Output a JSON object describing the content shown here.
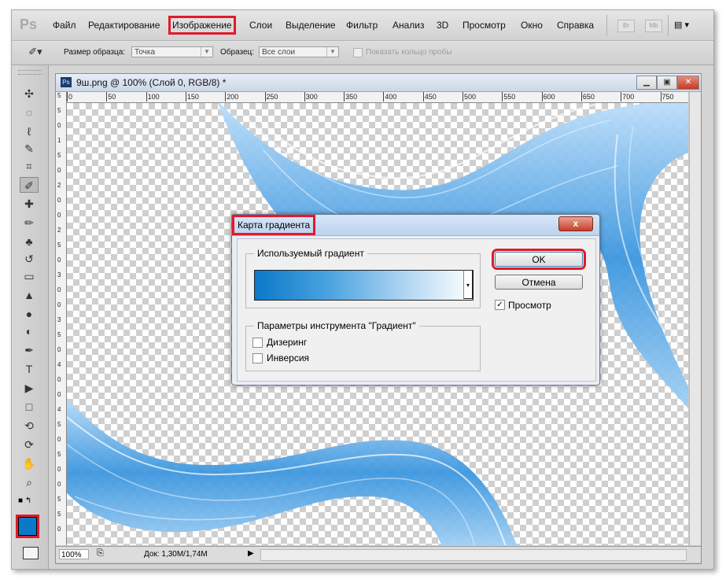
{
  "menubar": {
    "logo": "Ps",
    "items": [
      "Файл",
      "Редактирование",
      "Изображение",
      "Слои",
      "Выделение",
      "Фильтр",
      "Анализ",
      "3D",
      "Просмотр",
      "Окно",
      "Справка"
    ],
    "highlight_index": 2,
    "btn_br": "Br",
    "btn_mb": "Mb",
    "arrange_icon": "▤ ▾"
  },
  "options": {
    "sample_size_label": "Размер образца:",
    "sample_size_value": "Точка",
    "sample_label": "Образец:",
    "sample_value": "Все слои",
    "show_ring_label": "Показать кольцо пробы"
  },
  "toolbar": {
    "tools": [
      "move-icon",
      "marquee-icon",
      "lasso-icon",
      "quick-select-icon",
      "crop-icon",
      "eyedropper-icon",
      "healing-icon",
      "brush-icon",
      "stamp-icon",
      "history-brush-icon",
      "eraser-icon",
      "paint-bucket-icon",
      "blur-icon",
      "dodge-icon",
      "pen-icon",
      "type-icon",
      "path-select-icon",
      "shape-icon",
      "3d-rotate-icon",
      "3d-orbit-icon",
      "hand-icon",
      "zoom-icon"
    ],
    "glyphs": [
      "✣",
      "◌",
      "ℓ",
      "✎",
      "⌗",
      "✐",
      "✚",
      "✏",
      "♣",
      "↺",
      "▭",
      "▲",
      "●",
      "◐",
      "✒",
      "T",
      "▶",
      "□",
      "⟲",
      "⟳",
      "✋",
      "⌕"
    ],
    "active_index": 5,
    "foreground_color": "#0a79c9"
  },
  "document": {
    "title": "9ш.png @ 100% (Слой 0, RGB/8) *",
    "ruler_top": [
      "0",
      "50",
      "100",
      "150",
      "200",
      "250",
      "300",
      "350",
      "400",
      "450",
      "500",
      "550",
      "600",
      "650",
      "700",
      "750"
    ],
    "ruler_left": [
      "5",
      "5",
      "0",
      "1",
      "5",
      "0",
      "2",
      "0",
      "0",
      "2",
      "5",
      "0",
      "3",
      "0",
      "0",
      "3",
      "5",
      "0",
      "4",
      "0",
      "0",
      "4",
      "5",
      "0",
      "5",
      "0",
      "0",
      "5",
      "5",
      "0"
    ],
    "zoom": "100%",
    "doc_info": "Док: 1,30М/1,74М"
  },
  "dialog": {
    "title": "Карта градиента",
    "close_label": "x",
    "used_gradient_legend": "Используемый градиент",
    "tool_params_legend": "Параметры инструмента \"Градиент\"",
    "dither_label": "Дизеринг",
    "inverse_label": "Инверсия",
    "ok_label": "OK",
    "cancel_label": "Отмена",
    "preview_label": "Просмотр",
    "preview_checked": "✓",
    "gradient_colors": [
      "#0a79c9",
      "#4aa2e0",
      "#a9d2f1",
      "#ffffff"
    ]
  }
}
